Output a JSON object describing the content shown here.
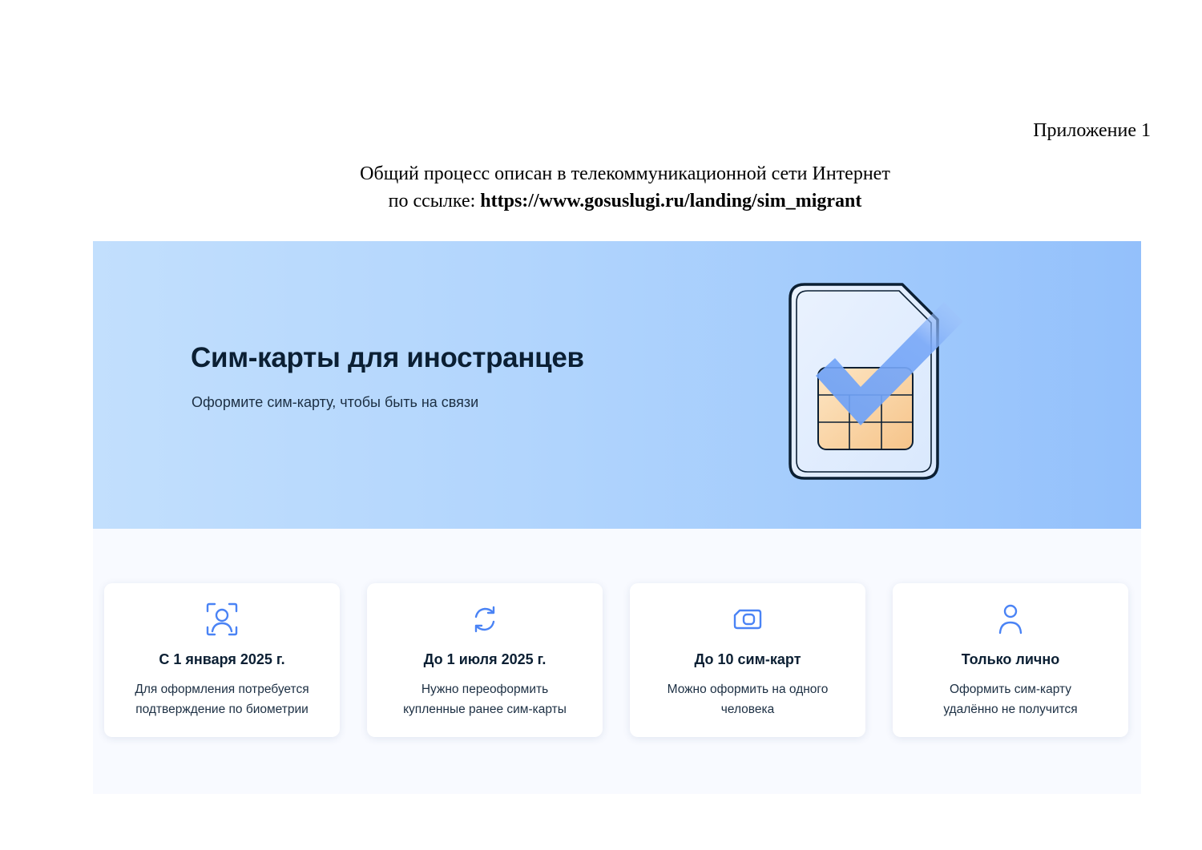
{
  "document": {
    "appendix_label": "Приложение 1",
    "intro_line1": "Общий процесс описан в телекоммуникационной сети Интернет",
    "intro_line2_prefix": "по ссылке: ",
    "intro_url": "https://www.gosuslugi.ru/landing/sim_migrant"
  },
  "hero": {
    "title": "Сим-карты для иностранцев",
    "subtitle": "Оформите сим-карту, чтобы быть на связи",
    "illustration_icon": "sim-card-check-icon"
  },
  "cards": [
    {
      "icon": "face-scan-icon",
      "title": "С 1 января 2025 г.",
      "text_line1": "Для оформления потребуется",
      "text_line2": "подтверждение по биометрии"
    },
    {
      "icon": "refresh-icon",
      "title": "До 1 июля 2025 г.",
      "text_line1": "Нужно переоформить",
      "text_line2": "купленные ранее сим-карты"
    },
    {
      "icon": "sim-card-icon",
      "title": "До 10 сим-карт",
      "text_line1": "Можно оформить на одного",
      "text_line2": "человека"
    },
    {
      "icon": "person-icon",
      "title": "Только лично",
      "text_line1": "Оформить сим-карту",
      "text_line2": "удалённо не получится"
    }
  ],
  "colors": {
    "accent": "#4a83f5",
    "heading": "#0b1f33",
    "hero_gradient_start": "#c2dffd",
    "hero_gradient_end": "#93c0fb"
  }
}
